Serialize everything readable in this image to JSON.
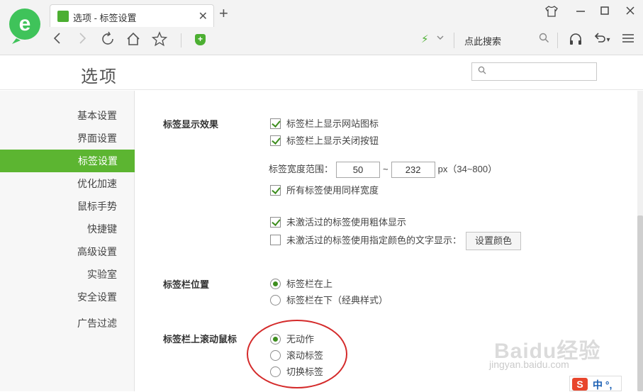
{
  "browser": {
    "tab_title": "选项 - 标签设置",
    "close_glyph": "✕",
    "newtab_glyph": "+",
    "search_placeholder": "点此搜索"
  },
  "header": {
    "title": "选项",
    "search_placeholder": ""
  },
  "sidebar": {
    "items": [
      {
        "label": "基本设置"
      },
      {
        "label": "界面设置"
      },
      {
        "label": "标签设置"
      },
      {
        "label": "优化加速"
      },
      {
        "label": "鼠标手势"
      },
      {
        "label": "快捷键"
      },
      {
        "label": "高级设置"
      },
      {
        "label": "实验室"
      },
      {
        "label": "安全设置"
      },
      {
        "label": "广告过滤"
      }
    ],
    "active_index": 2
  },
  "sections": {
    "display": {
      "label": "标签显示效果",
      "show_site_icon": {
        "label": "标签栏上显示网站图标",
        "checked": true
      },
      "show_close_btn": {
        "label": "标签栏上显示关闭按钮",
        "checked": true
      },
      "width_range_label": "标签宽度范围：",
      "width_min": "50",
      "tilde": "~",
      "width_max": "232",
      "width_unit": "px（34~800）",
      "same_width": {
        "label": "所有标签使用同样宽度",
        "checked": true
      },
      "bold_inactive": {
        "label": "未激活过的标签使用粗体显示",
        "checked": true
      },
      "color_inactive": {
        "label": "未激活过的标签使用指定颜色的文字显示：",
        "checked": false
      },
      "set_color_button": "设置颜色"
    },
    "position": {
      "label": "标签栏位置",
      "top": {
        "label": "标签栏在上",
        "selected": true
      },
      "bottom": {
        "label": "标签栏在下（经典样式）",
        "selected": false
      }
    },
    "wheel": {
      "label": "标签栏上滚动鼠标",
      "none": {
        "label": "无动作",
        "selected": true
      },
      "scroll": {
        "label": "滚动标签",
        "selected": false
      },
      "switch": {
        "label": "切换标签",
        "selected": false
      }
    }
  },
  "overlay": {
    "watermark": "Baidu经验",
    "watermark_url": "jingyan.baidu.com",
    "ime_logo": "S",
    "ime_text": "中 °,"
  },
  "colors": {
    "accent": "#5cb531",
    "annotation": "#d42a2a"
  }
}
